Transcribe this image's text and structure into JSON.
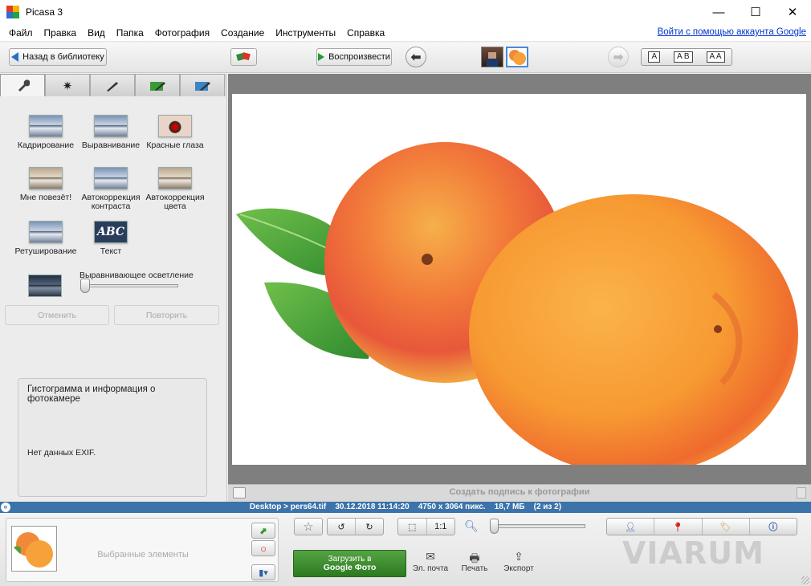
{
  "window": {
    "title": "Picasa 3",
    "controls": {
      "minimize": "—",
      "maximize": "☐",
      "close": "✕"
    }
  },
  "menu": {
    "items": [
      "Файл",
      "Правка",
      "Вид",
      "Папка",
      "Фотография",
      "Создание",
      "Инструменты",
      "Справка"
    ],
    "signin": "Войти с помощью аккаунта Google"
  },
  "toolbar": {
    "back_label": "Назад в библиотеку",
    "play_label": "Воспроизвести",
    "text_sizes": [
      "A",
      "A B",
      "A A"
    ]
  },
  "edit_panel": {
    "tabs": [
      "wrench-icon",
      "sun-icon",
      "brush-icon",
      "green-brush-icon",
      "blue-brush-icon"
    ],
    "tools": {
      "crop": "Кадрирование",
      "straighten": "Выравнивание",
      "redeye": "Красные глаза",
      "lucky": "Мне повезёт!",
      "auto_contrast": "Автокоррекция контраста",
      "auto_color": "Автокоррекция цвета",
      "retouch": "Ретуширование",
      "text": "Текст",
      "text_icon": "ABC"
    },
    "fill_light_label": "Выравнивающее осветление",
    "fill_light_level": 0,
    "undo": "Отменить",
    "redo": "Повторить",
    "histogram_title": "Гистограмма и информация о фотокамере",
    "exif_text": "Нет данных EXIF."
  },
  "caption": {
    "placeholder": "Создать подпись к фотографии"
  },
  "status": {
    "path": "Desktop > pers64.tif",
    "datetime": "30.12.2018 11:14:20",
    "dimensions": "4750 x 3064 пикс.",
    "size": "18,7 МБ",
    "position": "(2 из 2)"
  },
  "tray": {
    "label": "Выбранные элементы"
  },
  "bottom": {
    "upload_line1": "Загрузить в",
    "upload_line2": "Google Фото",
    "email": "Эл. почта",
    "print": "Печать",
    "export": "Экспорт",
    "one_to_one": "1:1",
    "zoom_level": 0
  },
  "watermark": "VIARUM",
  "colors": {
    "status_bar": "#3c73aa",
    "upload_button": "#3a8a2a",
    "link": "#0033cc"
  }
}
